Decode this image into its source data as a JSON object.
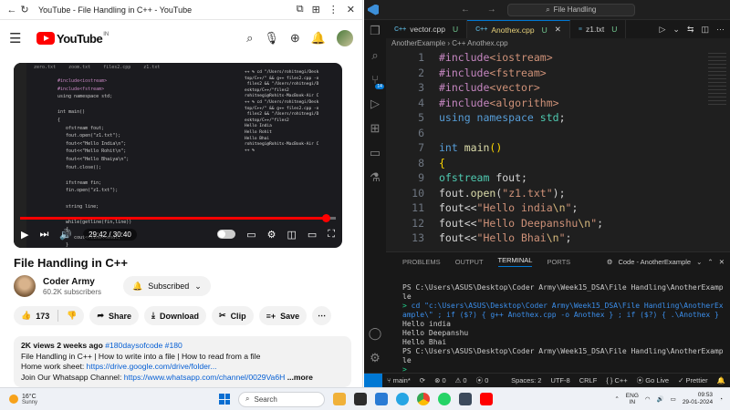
{
  "browser": {
    "tab_title": "YouTube - File Handling in C++ - YouTube"
  },
  "youtube": {
    "logo": "YouTube",
    "region": "IN",
    "player": {
      "time": "29:42 / 30:40",
      "progress_fraction": 0.968
    },
    "video_title": "File Handling in C++",
    "channel": {
      "name": "Coder Army",
      "subscribers": "60.2K subscribers"
    },
    "subscribed_label": "Subscribed",
    "like_count": "173",
    "share_label": "Share",
    "download_label": "Download",
    "clip_label": "Clip",
    "save_label": "Save",
    "description": {
      "views": "2K views",
      "ago": "2 weeks ago",
      "tags": "#180daysofcode #180",
      "line1": "File Handling in C++ | How to write into a file | How to read from a file",
      "line2_prefix": "Home work sheet: ",
      "line2_link": "https://drive.google.com/drive/folder...",
      "line3_prefix": "Join Our Whatsapp Channel: ",
      "line3_link": "https://www.whatsapp.com/channel/0029Va6H",
      "more": "...more"
    },
    "mini_video": {
      "tabs": [
        "zero.txt",
        "zoom.txt",
        "files2.cpp",
        "z1.txt"
      ],
      "code_lines": [
        "#include<iostream>",
        "#include<fstream>",
        "using namespace std;",
        "",
        "int main()",
        "{",
        "   ofstream fout;",
        "   fout.open(\"z1.txt\");",
        "   fout<<\"Hello India\\n\";",
        "   fout<<\"Hello Rohit\\n\";",
        "   fout<<\"Hello Bhaiya\\n\";",
        "   fout.close();",
        "",
        "   ifstream fin;",
        "   fin.open(\"z1.txt\");",
        "",
        "   string line;",
        "",
        "   while(getline(fin,line))",
        "   {",
        "      cout<<line<<endl;",
        "   }"
      ],
      "term_lines": [
        "++ % cd \"/Users/rohitnegi/Desk",
        "top/C++/\" && g++ files2.cpp -o",
        " files2 && \"/Users/rohitnegi/D",
        "esktop/C++/\"files2",
        "rohitnegi@Rohits-MacBook-Air C",
        "++ % cd \"/Users/rohitnegi/Desk",
        "top/C++/\" && g++ files2.cpp -o",
        " files2 && \"/Users/rohitnegi/D",
        "esktop/C++/\"files2",
        "Hello India",
        "Hello Rohit",
        "Hello Bhai",
        "rohitnegi@Rohits-MacBook-Air C",
        "++ % "
      ]
    }
  },
  "vscode": {
    "search_text": "File Handling",
    "tabs": [
      {
        "icon": "C++",
        "name": "vector.cpp",
        "status": "U",
        "active": false
      },
      {
        "icon": "C++",
        "name": "Anothex.cpp",
        "status": "U",
        "active": true
      },
      {
        "icon": "≡",
        "name": "z1.txt",
        "status": "U",
        "active": false
      }
    ],
    "breadcrumb": "AnotherExample  ›  C++  Anothex.cpp",
    "line_numbers": [
      "1",
      "2",
      "3",
      "4",
      "5",
      "6",
      "7",
      "8",
      "9",
      "10",
      "11",
      "12",
      "13"
    ],
    "panel_tabs": [
      "PROBLEMS",
      "OUTPUT",
      "TERMINAL",
      "PORTS"
    ],
    "panel_right": "Code - AnotherExample",
    "terminal_lines": [
      "PS C:\\Users\\ASUS\\Desktop\\Coder Army\\Week15_DSA\\File Handling\\AnotherExample",
      "> cd \"c:\\Users\\ASUS\\Desktop\\Coder Army\\Week15_DSA\\File Handling\\AnotherExample\\\" ; if ($?) { g++ Anothex.cpp -o Anothex } ; if ($?) { .\\Anothex }",
      "Hello india",
      "Hello Deepanshu",
      "Hello Bhai",
      "PS C:\\Users\\ASUS\\Desktop\\Coder Army\\Week15_DSA\\File Handling\\AnotherExample",
      "> "
    ],
    "status": {
      "branch": "main*",
      "sync": "⟳",
      "errors": "⊗ 0",
      "warnings": "⚠ 0",
      "ports": "⦿ 0",
      "spaces": "Spaces: 2",
      "encoding": "UTF-8",
      "eol": "CRLF",
      "lang": "C++",
      "golive": "Go Live",
      "prettier": "✓ Prettier"
    }
  },
  "taskbar": {
    "temp": "16°C",
    "condition": "Sunny",
    "search_placeholder": "Search",
    "lang_1": "ENG",
    "lang_2": "IN",
    "time": "09:53",
    "date": "29-01-2024"
  }
}
